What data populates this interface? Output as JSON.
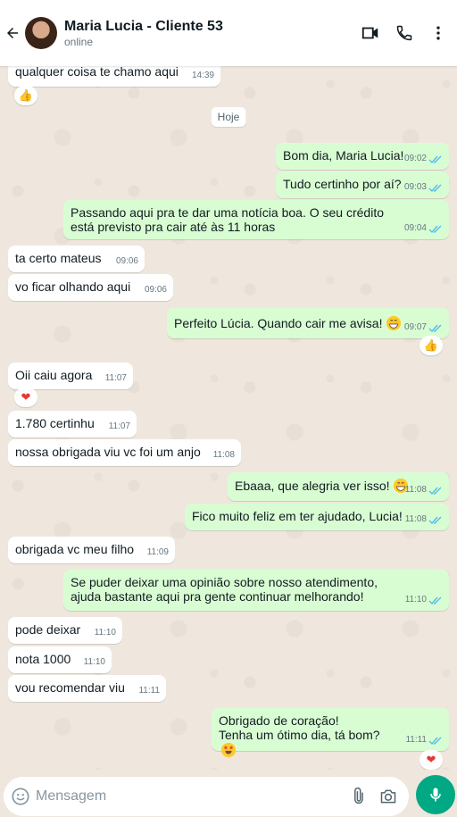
{
  "header": {
    "name": "Maria Lucia - Cliente 53",
    "status": "online"
  },
  "chat": {
    "day_chip": "Hoje",
    "messages": [
      {
        "dir": "in",
        "text": "qualquer coisa te chamo aqui",
        "time": "14:39",
        "reaction": "thumbs-up"
      },
      {
        "dir": "out",
        "text": "Bom dia, Maria Lucia!",
        "time": "09:02"
      },
      {
        "dir": "out",
        "text": "Tudo certinho por aí?",
        "time": "09:03"
      },
      {
        "dir": "out",
        "text": "Passando aqui pra te dar uma notícia boa. O seu crédito está previsto pra cair até às 11 horas",
        "time": "09:04"
      },
      {
        "dir": "in",
        "text": "ta certo mateus",
        "time": "09:06"
      },
      {
        "dir": "in",
        "text": "vo ficar olhando aqui",
        "time": "09:06"
      },
      {
        "dir": "out",
        "text": "Perfeito Lúcia. Quando cair me avisa!",
        "time": "09:07",
        "reaction": "thumbs-up"
      },
      {
        "dir": "in",
        "text": "Oii caiu agora",
        "time": "11:07",
        "reaction": "heart"
      },
      {
        "dir": "in",
        "text": "1.780 certinhu",
        "time": "11:07"
      },
      {
        "dir": "in",
        "text": "nossa obrigada viu vc foi um anjo",
        "time": "11:08"
      },
      {
        "dir": "out",
        "text": "Ebaaa, que alegria ver isso!",
        "time": "11:08"
      },
      {
        "dir": "out",
        "text": "Fico muito feliz em ter ajudado, Lucia!",
        "time": "11:08"
      },
      {
        "dir": "in",
        "text": "obrigada vc meu filho",
        "time": "11:09"
      },
      {
        "dir": "out",
        "text": "Se puder deixar uma opinião sobre nosso atendimento, ajuda bastante aqui pra gente continuar melhorando!",
        "time": "11:10"
      },
      {
        "dir": "in",
        "text": "pode deixar",
        "time": "11:10"
      },
      {
        "dir": "in",
        "text": "nota 1000",
        "time": "11:10"
      },
      {
        "dir": "in",
        "text": "vou recomendar viu",
        "time": "11:11"
      },
      {
        "dir": "out",
        "text": "Obrigado de coração!\nTenha um ótimo dia, tá bom?",
        "time": "11:11",
        "reaction": "heart"
      }
    ]
  },
  "composer": {
    "placeholder": "Mensagem"
  },
  "colors": {
    "incoming": "#ffffff",
    "outgoing": "#d9fdd3",
    "read_tick": "#53bdeb",
    "accent": "#00a884"
  }
}
